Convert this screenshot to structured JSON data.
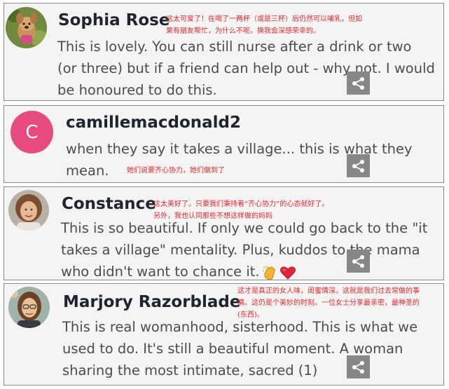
{
  "comments": [
    {
      "author": "Sophia Rose",
      "avatar_icon": "dog-photo-avatar",
      "text_lines": [
        "This is lovely. You can still nurse after a drink or two",
        "(or three) but if a friend can help out - why not. I would",
        "be honoured to do this."
      ],
      "translation_lines": [
        "这太可爱了！在喝了一两杯（或是三杯）后仍然可以哺乳，但如",
        "果有朋友帮忙，为什么不呢，换我会深感荣幸的。"
      ],
      "share_icon": "share-icon"
    },
    {
      "author": "camillemacdonald2",
      "avatar_letter": "C",
      "avatar_color": "#e64a7e",
      "text_lines": [
        "when they say it takes a village... this is what they",
        "mean."
      ],
      "translation_lines": [
        "她们说要齐心协力，她们做到了"
      ],
      "share_icon": "share-icon"
    },
    {
      "author": "Constance",
      "avatar_icon": "woman-photo-avatar",
      "text_lines": [
        "This is so beautiful. If only we could go back to the \"it",
        "takes a village\" mentality. Plus, kuddos to the mama",
        "who didn't want to chance it."
      ],
      "emojis": [
        "clapping-hands-emoji",
        "red-heart-emoji"
      ],
      "translation_lines": [
        "这太美好了。只要我们秉持着“齐心协力”的心态就好了。",
        "另外，我也认同那些不想这样做的妈妈"
      ],
      "share_icon": "share-icon"
    },
    {
      "author": "Marjory Razorblade",
      "avatar_icon": "woman-glasses-photo-avatar",
      "text_lines": [
        "This is real womanhood, sisterhood. This is what we",
        "used to do. It's still a beautiful moment. A woman",
        "sharing the most intimate, sacred (1)"
      ],
      "translation_lines": [
        "这才是真正的女人味，闺蜜情深。这就是我们过去常做的事",
        "情。这仍是个美妙的时刻。一位女士分享最亲密，最神圣的",
        "(东西)。"
      ],
      "share_icon": "share-icon"
    }
  ],
  "colors": {
    "card_bg": "#f4f4f4",
    "card_border": "#8a8a8a",
    "author": "#1f2430",
    "body": "#4c4c4c",
    "annotation": "#e8272b",
    "share_bg": "#878787"
  }
}
